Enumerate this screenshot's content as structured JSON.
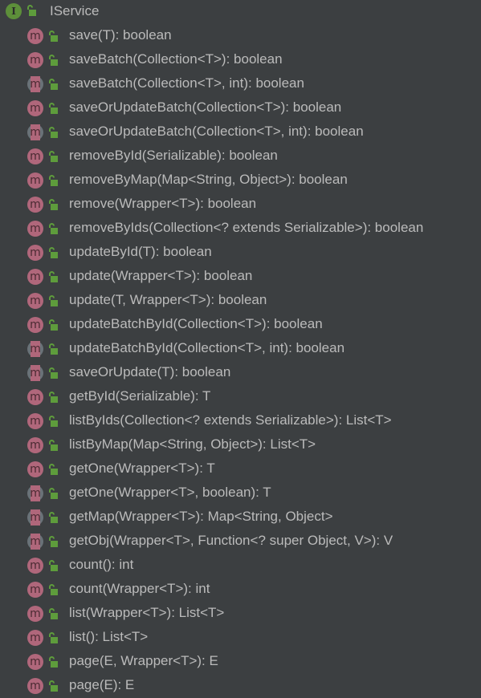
{
  "root": {
    "label": "IService",
    "icon": "interface-icon"
  },
  "colors": {
    "background": "#3c3f41",
    "text": "#bbbbbb",
    "method": "#b0677b",
    "interface": "#5d8f3a",
    "lock": "#5e9c3c"
  },
  "methods": [
    {
      "label": "save(T): boolean",
      "default": false
    },
    {
      "label": "saveBatch(Collection<T>): boolean",
      "default": false
    },
    {
      "label": "saveBatch(Collection<T>, int): boolean",
      "default": true
    },
    {
      "label": "saveOrUpdateBatch(Collection<T>): boolean",
      "default": false
    },
    {
      "label": "saveOrUpdateBatch(Collection<T>, int): boolean",
      "default": true
    },
    {
      "label": "removeById(Serializable): boolean",
      "default": false
    },
    {
      "label": "removeByMap(Map<String, Object>): boolean",
      "default": false
    },
    {
      "label": "remove(Wrapper<T>): boolean",
      "default": false
    },
    {
      "label": "removeByIds(Collection<? extends Serializable>): boolean",
      "default": false
    },
    {
      "label": "updateById(T): boolean",
      "default": false
    },
    {
      "label": "update(Wrapper<T>): boolean",
      "default": false
    },
    {
      "label": "update(T, Wrapper<T>): boolean",
      "default": false
    },
    {
      "label": "updateBatchById(Collection<T>): boolean",
      "default": false
    },
    {
      "label": "updateBatchById(Collection<T>, int): boolean",
      "default": true
    },
    {
      "label": "saveOrUpdate(T): boolean",
      "default": true
    },
    {
      "label": "getById(Serializable): T",
      "default": false
    },
    {
      "label": "listByIds(Collection<? extends Serializable>): List<T>",
      "default": false
    },
    {
      "label": "listByMap(Map<String, Object>): List<T>",
      "default": false
    },
    {
      "label": "getOne(Wrapper<T>): T",
      "default": false
    },
    {
      "label": "getOne(Wrapper<T>, boolean): T",
      "default": true
    },
    {
      "label": "getMap(Wrapper<T>): Map<String, Object>",
      "default": true
    },
    {
      "label": "getObj(Wrapper<T>, Function<? super Object, V>): V",
      "default": true
    },
    {
      "label": "count(): int",
      "default": false
    },
    {
      "label": "count(Wrapper<T>): int",
      "default": false
    },
    {
      "label": "list(Wrapper<T>): List<T>",
      "default": false
    },
    {
      "label": "list(): List<T>",
      "default": false
    },
    {
      "label": "page(E, Wrapper<T>): E",
      "default": false
    },
    {
      "label": "page(E): E",
      "default": false
    }
  ]
}
